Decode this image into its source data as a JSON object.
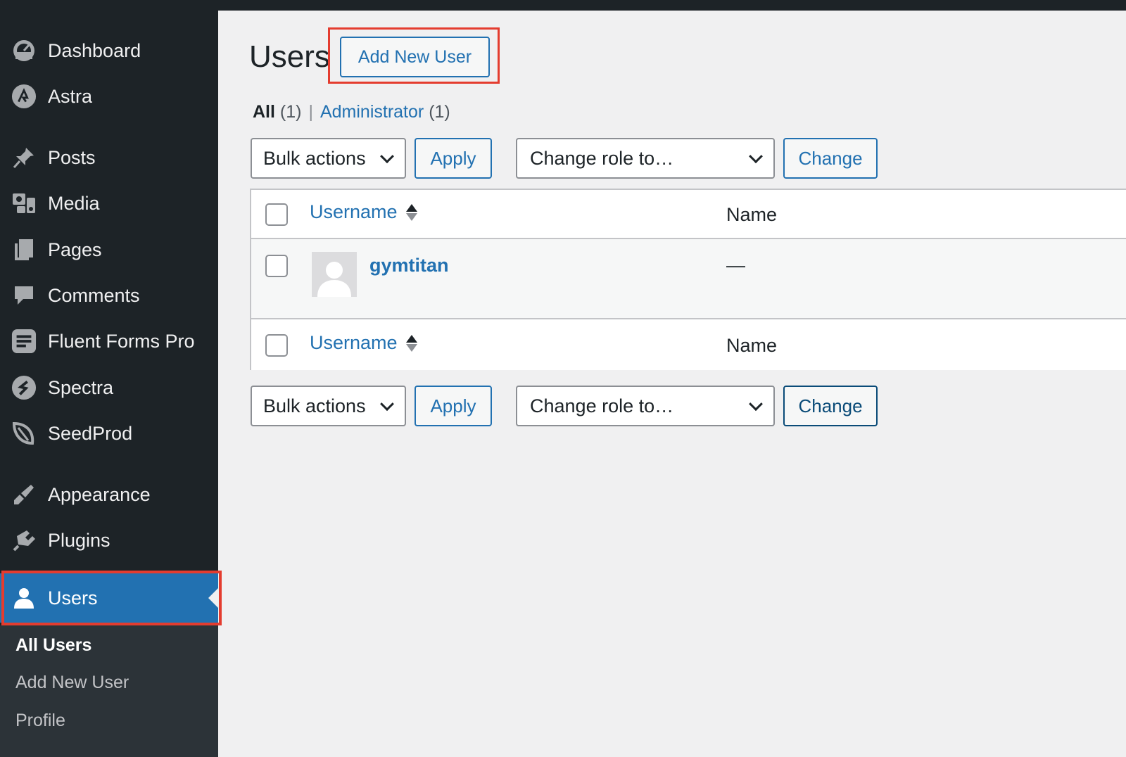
{
  "sidebar": {
    "items": [
      {
        "label": "Dashboard",
        "icon": "dashboard-icon"
      },
      {
        "label": "Astra",
        "icon": "astra-icon"
      },
      {
        "label": "Posts",
        "icon": "pin-icon"
      },
      {
        "label": "Media",
        "icon": "media-icon"
      },
      {
        "label": "Pages",
        "icon": "pages-icon"
      },
      {
        "label": "Comments",
        "icon": "comment-icon"
      },
      {
        "label": "Fluent Forms Pro",
        "icon": "fluent-forms-icon"
      },
      {
        "label": "Spectra",
        "icon": "spectra-icon"
      },
      {
        "label": "SeedProd",
        "icon": "seedprod-icon"
      },
      {
        "label": "Appearance",
        "icon": "brush-icon"
      },
      {
        "label": "Plugins",
        "icon": "plugin-icon"
      },
      {
        "label": "Users",
        "icon": "user-icon",
        "active": true
      }
    ],
    "submenu": [
      {
        "label": "All Users",
        "current": true
      },
      {
        "label": "Add New User"
      },
      {
        "label": "Profile"
      }
    ]
  },
  "main": {
    "title": "Users",
    "add_new_label": "Add New User",
    "filters": {
      "all_label": "All",
      "all_count": "(1)",
      "separator": "|",
      "admin_label": "Administrator",
      "admin_count": "(1)"
    },
    "toolbar": {
      "bulk_actions": "Bulk actions",
      "apply": "Apply",
      "change_role": "Change role to…",
      "change": "Change"
    },
    "table": {
      "columns": {
        "username": "Username",
        "name": "Name"
      },
      "rows": [
        {
          "username": "gymtitan",
          "name": "—"
        }
      ]
    }
  },
  "colors": {
    "sidebar_bg": "#1d2327",
    "accent": "#2271b1",
    "highlight_outline": "#e43c2f",
    "page_bg": "#f0f0f1"
  }
}
